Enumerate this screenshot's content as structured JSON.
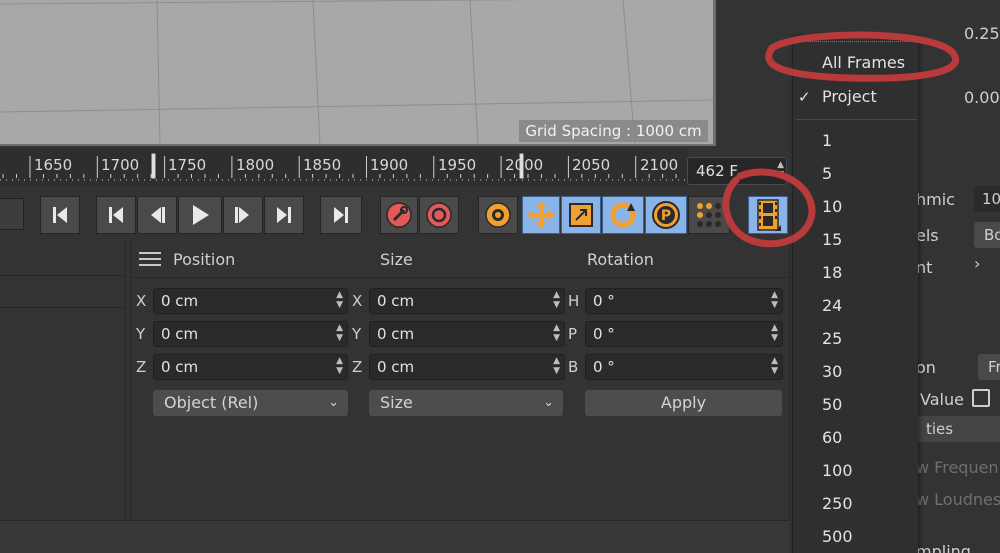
{
  "viewport": {
    "grid_label": "Grid Spacing : 1000 cm"
  },
  "timeline": {
    "ticks": [
      "1650",
      "1700",
      "1750",
      "1800",
      "1850",
      "1900",
      "1950",
      "2000",
      "2050",
      "2100"
    ],
    "current_frame": "462 F"
  },
  "coord": {
    "headers": {
      "position": "Position",
      "size": "Size",
      "rotation": "Rotation"
    },
    "axes_pos": [
      "X",
      "Y",
      "Z"
    ],
    "axes_size": [
      "X",
      "Y",
      "Z"
    ],
    "axes_rot": [
      "H",
      "P",
      "B"
    ],
    "position_values": [
      "0 cm",
      "0 cm",
      "0 cm"
    ],
    "size_values": [
      "0 cm",
      "0 cm",
      "0 cm"
    ],
    "rotation_values": [
      "0 °",
      "0 °",
      "0 °"
    ],
    "mode_dropdown": "Object (Rel)",
    "size_dropdown": "Size",
    "apply_label": "Apply"
  },
  "right_panel": {
    "value_a": "0.25",
    "value_b": "0.00",
    "label_hmic": "hmic",
    "field_10": "10",
    "label_els": "els",
    "btn_bo": "Bo",
    "label_nt": "nt",
    "label_on": "on",
    "btn_fr": "Fr",
    "label_value": "Value",
    "label_ties": "ties",
    "label_freq": "w Frequen",
    "label_loud": "w Loudnes",
    "label_mpling": "mpling"
  },
  "frame_menu": {
    "items": [
      {
        "label": "All Frames",
        "checked": false
      },
      {
        "label": "Project",
        "checked": true
      }
    ],
    "rates": [
      "1",
      "5",
      "10",
      "15",
      "18",
      "24",
      "25",
      "30",
      "50",
      "60",
      "100",
      "250",
      "500"
    ],
    "check_glyph": "✓"
  },
  "colors": {
    "annotation": "#b83a3a",
    "accent_blue": "#8ab4e8",
    "record": "#e05a5a",
    "orange": "#f0a030"
  }
}
